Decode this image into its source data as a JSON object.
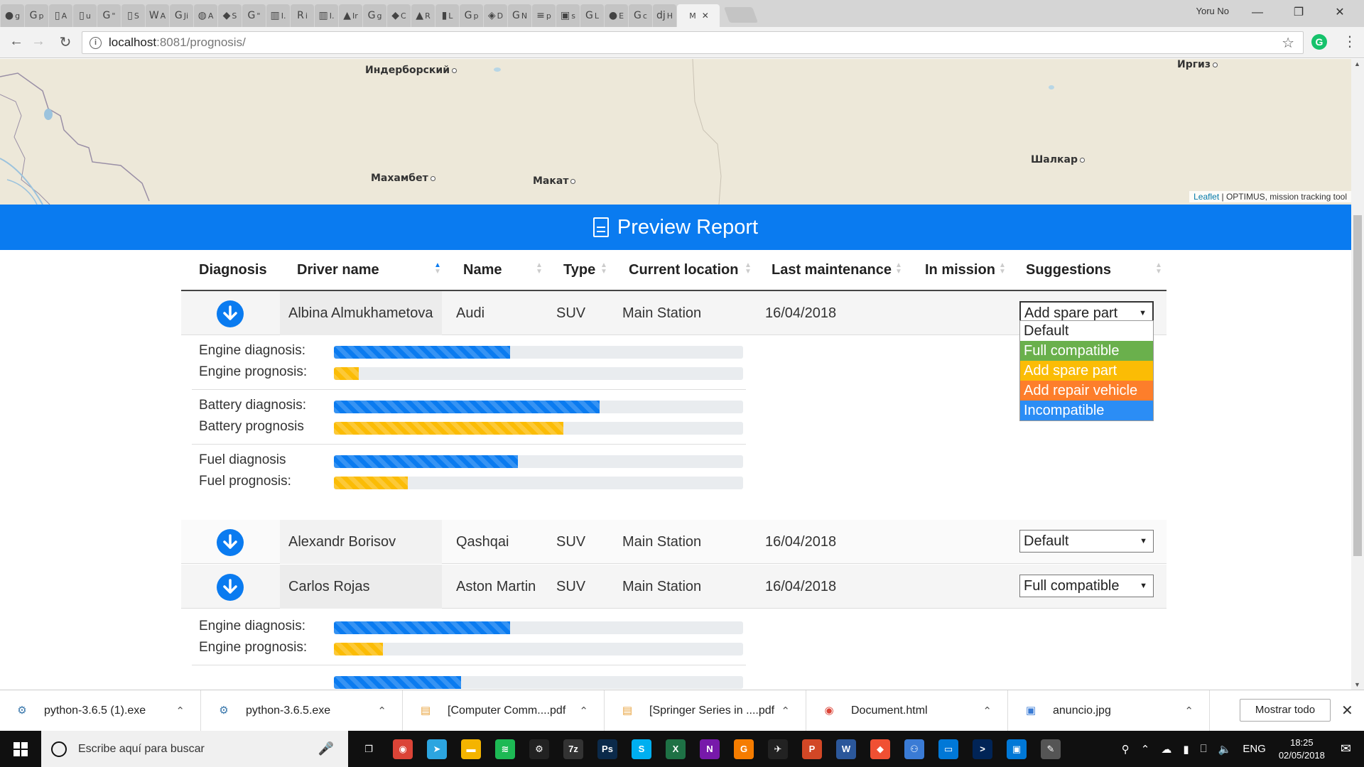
{
  "browser": {
    "tabs": [
      {
        "icon": "github-icon",
        "glyph": "●",
        "text": "g"
      },
      {
        "icon": "google-icon",
        "glyph": "G",
        "text": "p"
      },
      {
        "icon": "document-icon",
        "glyph": "▯",
        "text": "A"
      },
      {
        "icon": "document-icon",
        "glyph": "▯",
        "text": "u"
      },
      {
        "icon": "google-icon",
        "glyph": "G",
        "text": "\""
      },
      {
        "icon": "document-icon",
        "glyph": "▯",
        "text": "S"
      },
      {
        "icon": "wikipedia-icon",
        "glyph": "W",
        "text": "A"
      },
      {
        "icon": "google-icon",
        "glyph": "G",
        "text": "Ji"
      },
      {
        "icon": "colorwheel-icon",
        "glyph": "◍",
        "text": "A"
      },
      {
        "icon": "stackexchange-icon",
        "glyph": "◆",
        "text": "S"
      },
      {
        "icon": "google-icon",
        "glyph": "G",
        "text": "\""
      },
      {
        "icon": "barcode-icon",
        "glyph": "▥",
        "text": "I."
      },
      {
        "icon": "researchgate-icon",
        "glyph": "R",
        "text": "i"
      },
      {
        "icon": "barcode-icon",
        "glyph": "▥",
        "text": "I."
      },
      {
        "icon": "drive-icon",
        "glyph": "▲",
        "text": "Ir"
      },
      {
        "icon": "google-icon",
        "glyph": "G",
        "text": "g"
      },
      {
        "icon": "git-icon",
        "glyph": "◆",
        "text": "C"
      },
      {
        "icon": "drive-icon",
        "glyph": "▲",
        "text": "R"
      },
      {
        "icon": "bookmark-icon",
        "glyph": "▮",
        "text": "L"
      },
      {
        "icon": "google-icon",
        "glyph": "G",
        "text": "p"
      },
      {
        "icon": "python-icon",
        "glyph": "◈",
        "text": "D"
      },
      {
        "icon": "google-icon",
        "glyph": "G",
        "text": "N"
      },
      {
        "icon": "stackoverflow-icon",
        "glyph": "≡",
        "text": "p"
      },
      {
        "icon": "cube-icon",
        "glyph": "▣",
        "text": "s"
      },
      {
        "icon": "google-icon",
        "glyph": "G",
        "text": "L"
      },
      {
        "icon": "github-icon",
        "glyph": "●",
        "text": "E"
      },
      {
        "icon": "google-icon",
        "glyph": "G",
        "text": "c"
      },
      {
        "icon": "django-icon",
        "glyph": "dj",
        "text": "H"
      },
      {
        "icon": "blank-page-icon",
        "glyph": "",
        "text": "M",
        "active": true
      }
    ],
    "user_name": "Yoru No",
    "address": "localhost:8081/prognosis/",
    "address_host": "localhost",
    "address_rest": ":8081/prognosis/"
  },
  "map": {
    "cities": [
      {
        "name": "Индерборский"
      },
      {
        "name": "Иргиз"
      },
      {
        "name": "Шалкар"
      },
      {
        "name": "Махамбет"
      },
      {
        "name": "Макат"
      }
    ],
    "attribution_link": "Leaflet",
    "attribution_text": " | OPTIMUS, mission tracking tool"
  },
  "report": {
    "title": "Preview Report",
    "columns": [
      "Diagnosis",
      "Driver name",
      "Name",
      "Type",
      "Current location",
      "Last maintenance",
      "In mission",
      "Suggestions"
    ],
    "sorted_column": "Driver name",
    "rows": [
      {
        "driver": "Albina Almukhametova",
        "name": "Audi",
        "type": "SUV",
        "location": "Main Station",
        "maintenance": "16/04/2018",
        "in_mission": "",
        "suggestion": "Add spare part"
      },
      {
        "driver": "Alexandr Borisov",
        "name": "Qashqai",
        "type": "SUV",
        "location": "Main Station",
        "maintenance": "16/04/2018",
        "in_mission": "",
        "suggestion": "Default"
      },
      {
        "driver": "Carlos Rojas",
        "name": "Aston Martin",
        "type": "SUV",
        "location": "Main Station",
        "maintenance": "16/04/2018",
        "in_mission": "",
        "suggestion": "Full compatible"
      }
    ],
    "dropdown_options": [
      {
        "label": "Default",
        "bg": "#ffffff",
        "fg": "#222222"
      },
      {
        "label": "Full compatible",
        "bg": "#6ab04c",
        "fg": "#ffffff"
      },
      {
        "label": "Add spare part",
        "bg": "#fbbc05",
        "fg": "#ffffff"
      },
      {
        "label": "Add repair vehicle",
        "bg": "#fd7e2b",
        "fg": "#ffffff"
      },
      {
        "label": "Incompatible",
        "bg": "#2b8df5",
        "fg": "#ffffff"
      }
    ],
    "details_1": [
      [
        {
          "label": "Engine diagnosis:",
          "value": 0.43,
          "color": "blue"
        },
        {
          "label": "Engine prognosis:",
          "value": 0.06,
          "color": "orange"
        }
      ],
      [
        {
          "label": "Battery diagnosis:",
          "value": 0.65,
          "color": "blue"
        },
        {
          "label": "Battery prognosis",
          "value": 0.56,
          "color": "orange"
        }
      ],
      [
        {
          "label": "Fuel diagnosis",
          "value": 0.45,
          "color": "blue"
        },
        {
          "label": "Fuel prognosis:",
          "value": 0.18,
          "color": "orange"
        }
      ]
    ],
    "details_3": [
      [
        {
          "label": "Engine diagnosis:",
          "value": 0.43,
          "color": "blue"
        },
        {
          "label": "Engine prognosis:",
          "value": 0.12,
          "color": "orange"
        }
      ],
      [
        {
          "label": "",
          "value": 0.31,
          "color": "blue"
        }
      ]
    ]
  },
  "downloads": {
    "items": [
      {
        "name": "python-3.6.5 (1).exe",
        "icon": "python-installer-icon"
      },
      {
        "name": "python-3.6.5.exe",
        "icon": "python-installer-icon"
      },
      {
        "name": "[Computer Comm....pdf",
        "icon": "pdf-file-icon"
      },
      {
        "name": "[Springer Series in ....pdf",
        "icon": "pdf-file-icon"
      },
      {
        "name": "Document.html",
        "icon": "chrome-file-icon"
      },
      {
        "name": "anuncio.jpg",
        "icon": "image-file-icon"
      }
    ],
    "show_all": "Mostrar todo"
  },
  "taskbar": {
    "search_placeholder": "Escribe aquí para buscar",
    "apps": [
      {
        "icon": "task-view-icon",
        "color": "#101010",
        "glyph": "❐"
      },
      {
        "icon": "chrome-icon",
        "color": "#db4437",
        "glyph": "◉"
      },
      {
        "icon": "telegram-icon",
        "color": "#2ca5e0",
        "glyph": "➤"
      },
      {
        "icon": "file-explorer-icon",
        "color": "#f4b400",
        "glyph": "▬"
      },
      {
        "icon": "spotify-icon",
        "color": "#1db954",
        "glyph": "≋"
      },
      {
        "icon": "steam-icon",
        "color": "#222222",
        "glyph": "⚙"
      },
      {
        "icon": "7zip-icon",
        "color": "#333333",
        "glyph": "7z"
      },
      {
        "icon": "photoshop-icon",
        "color": "#0b2a4a",
        "glyph": "Ps"
      },
      {
        "icon": "skype-icon",
        "color": "#00aff0",
        "glyph": "S"
      },
      {
        "icon": "excel-icon",
        "color": "#1e7145",
        "glyph": "X"
      },
      {
        "icon": "onenote-icon",
        "color": "#7719aa",
        "glyph": "N"
      },
      {
        "icon": "pdf-reader-icon",
        "color": "#f57c00",
        "glyph": "G"
      },
      {
        "icon": "pycharm-icon",
        "color": "#222222",
        "glyph": "✈"
      },
      {
        "icon": "powerpoint-icon",
        "color": "#d24726",
        "glyph": "P"
      },
      {
        "icon": "word-icon",
        "color": "#2b579a",
        "glyph": "W"
      },
      {
        "icon": "git-gui-icon",
        "color": "#f05033",
        "glyph": "◆"
      },
      {
        "icon": "network-icon",
        "color": "#3a7bd5",
        "glyph": "⚇"
      },
      {
        "icon": "remote-desktop-icon",
        "color": "#0078d7",
        "glyph": "▭"
      },
      {
        "icon": "powershell-icon",
        "color": "#012456",
        "glyph": ">"
      },
      {
        "icon": "monitor-icon",
        "color": "#0078d7",
        "glyph": "▣"
      },
      {
        "icon": "paint-icon",
        "color": "#555555",
        "glyph": "✎"
      }
    ],
    "language": "ENG",
    "time": "18:25",
    "date": "02/05/2018"
  }
}
